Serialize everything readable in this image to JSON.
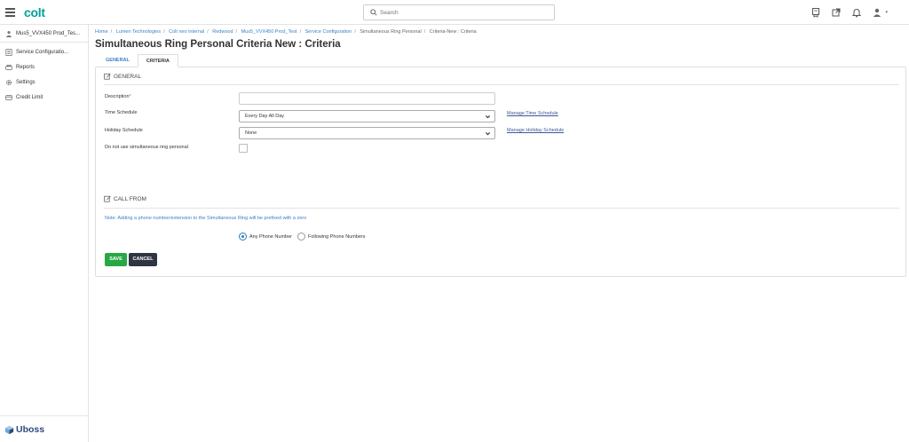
{
  "app": {
    "logo": "colt"
  },
  "search": {
    "placeholder": "Search"
  },
  "sidebar": {
    "items": [
      {
        "label": "Mus5_VVX450 Prod_Tes..."
      },
      {
        "label": "Service Configuratio..."
      },
      {
        "label": "Reports"
      },
      {
        "label": "Settings"
      },
      {
        "label": "Credit Limit"
      }
    ],
    "footer_logo": "Uboss"
  },
  "breadcrumb": [
    {
      "label": "Home"
    },
    {
      "label": "Lumen Technologies"
    },
    {
      "label": "Colt neo internal"
    },
    {
      "label": "Redwood"
    },
    {
      "label": "Mus5_VVX450 Prod_Test"
    },
    {
      "label": "Service Configuration"
    },
    {
      "label": "Simultaneous Ring Personal"
    },
    {
      "label": "Criteria-New : Criteria"
    }
  ],
  "page": {
    "title": "Simultaneous Ring Personal Criteria New : Criteria"
  },
  "tabs": [
    {
      "label": "GENERAL"
    },
    {
      "label": "CRITERIA"
    }
  ],
  "form": {
    "general_section": "GENERAL",
    "description_label": "Description",
    "required_mark": "*",
    "description_value": "",
    "time_schedule_label": "Time Schedule",
    "time_schedule_value": "Every Day All Day",
    "manage_time_link": "Manage Time Schedule",
    "holiday_schedule_label": "Holiday Schedule",
    "holiday_schedule_value": "None",
    "manage_holiday_link": "Manage Holiday Schedule",
    "do_not_use_label": "Do not use simultaneous ring personal",
    "call_from_section": "CALL FROM",
    "note": "Note: Adding a phone number/extension to the Simultaneous Ring will be prefixed with a zero",
    "radio_any": "Any Phone Number",
    "radio_following": "Following Phone Numbers"
  },
  "buttons": {
    "save": "SAVE",
    "cancel": "CANCEL"
  },
  "colors": {
    "brand": "#00a19a",
    "link": "#3b82c4",
    "save": "#28a745",
    "cancel": "#2f3542"
  }
}
